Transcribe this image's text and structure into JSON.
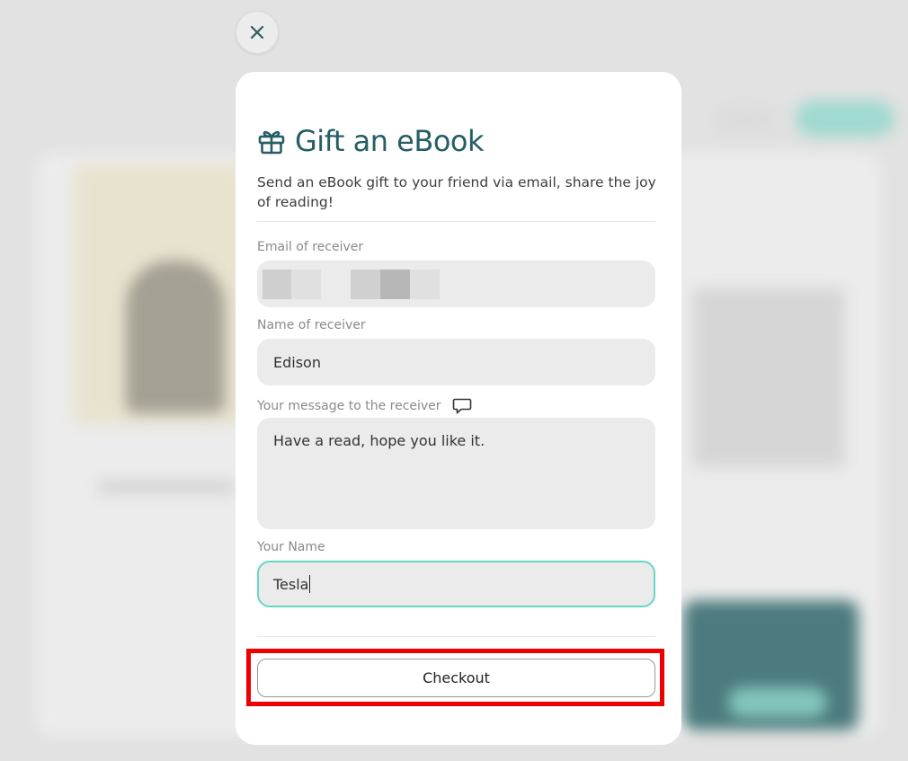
{
  "close_button": {
    "icon": "close-icon"
  },
  "modal": {
    "title": "Gift an eBook",
    "title_icon": "gift-icon",
    "subtitle": "Send an eBook gift to your friend via email, share the joy of reading!",
    "fields": {
      "email": {
        "label": "Email of receiver",
        "value": ""
      },
      "receiver_name": {
        "label": "Name of receiver",
        "value": "Edison"
      },
      "message": {
        "label": "Your message to the receiver",
        "label_icon": "message-icon",
        "value": "Have a read, hope you like it."
      },
      "your_name": {
        "label": "Your Name",
        "value": "Tesla"
      }
    },
    "checkout_label": "Checkout"
  },
  "colors": {
    "accent": "#265e66",
    "focus_border": "#6bd5c3",
    "highlight": "#ee0000"
  }
}
